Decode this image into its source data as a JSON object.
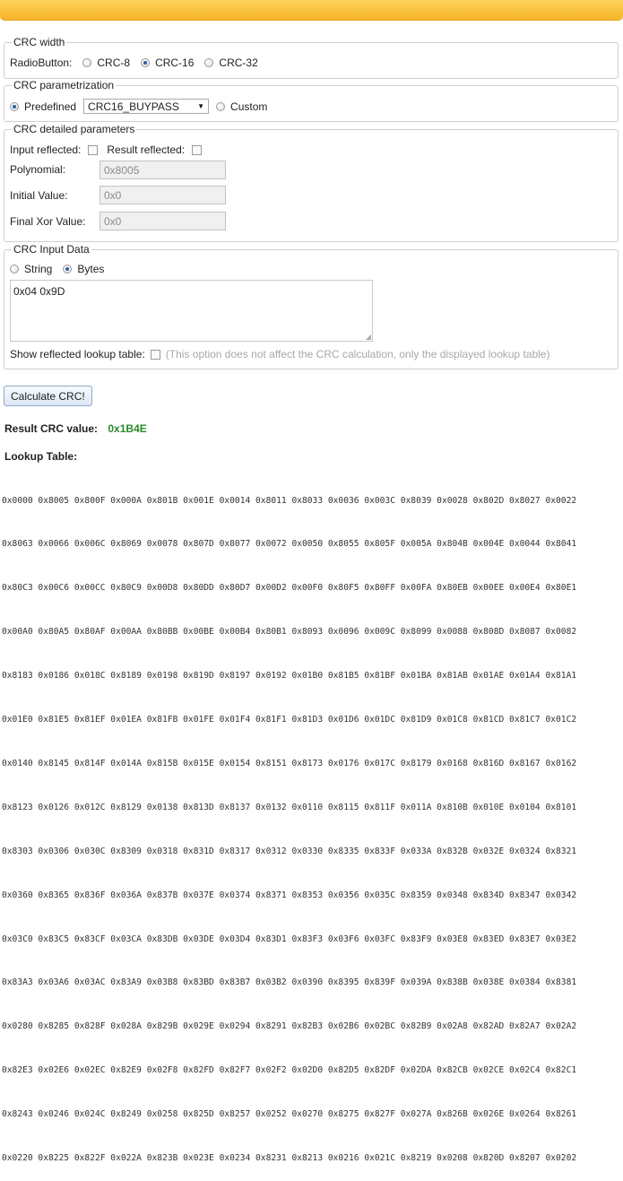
{
  "crc_width": {
    "legend": "CRC width",
    "label": "RadioButton:",
    "options": [
      "CRC-8",
      "CRC-16",
      "CRC-32"
    ],
    "selected": "CRC-16"
  },
  "crc_param": {
    "legend": "CRC parametrization",
    "predefined_label": "Predefined",
    "predefined_selected": true,
    "select_value": "CRC16_BUYPASS",
    "custom_label": "Custom"
  },
  "detailed": {
    "legend": "CRC detailed parameters",
    "input_reflected_label": "Input reflected:",
    "result_reflected_label": "Result reflected:",
    "polynomial_label": "Polynomial:",
    "polynomial_value": "0x8005",
    "initial_label": "Initial Value:",
    "initial_value": "0x0",
    "final_label": "Final Xor Value:",
    "final_value": "0x0"
  },
  "input_data": {
    "legend": "CRC Input Data",
    "string_label": "String",
    "bytes_label": "Bytes",
    "selected": "Bytes",
    "text": "0x04 0x9D",
    "reflected_label": "Show reflected lookup table:",
    "reflected_note": "(This option does not affect the CRC calculation, only the displayed lookup table)"
  },
  "calculate_label": "Calculate CRC!",
  "result": {
    "label": "Result CRC value:",
    "value": "0x1B4E"
  },
  "lookup": {
    "title": "Lookup Table:",
    "rows": [
      "0x0000 0x8005 0x800F 0x000A 0x801B 0x001E 0x0014 0x8011 0x8033 0x0036 0x003C 0x8039 0x0028 0x802D 0x8027 0x0022",
      "0x8063 0x0066 0x006C 0x8069 0x0078 0x807D 0x8077 0x0072 0x0050 0x8055 0x805F 0x005A 0x804B 0x004E 0x0044 0x8041",
      "0x80C3 0x00C6 0x00CC 0x80C9 0x00D8 0x80DD 0x80D7 0x00D2 0x00F0 0x80F5 0x80FF 0x00FA 0x80EB 0x00EE 0x00E4 0x80E1",
      "0x00A0 0x80A5 0x80AF 0x00AA 0x80BB 0x00BE 0x00B4 0x80B1 0x8093 0x0096 0x009C 0x8099 0x0088 0x808D 0x8087 0x0082",
      "0x8183 0x0186 0x018C 0x8189 0x0198 0x819D 0x8197 0x0192 0x01B0 0x81B5 0x81BF 0x01BA 0x81AB 0x01AE 0x01A4 0x81A1",
      "0x01E0 0x81E5 0x81EF 0x01EA 0x81FB 0x01FE 0x01F4 0x81F1 0x81D3 0x01D6 0x01DC 0x81D9 0x01C8 0x81CD 0x81C7 0x01C2",
      "0x0140 0x8145 0x814F 0x014A 0x815B 0x015E 0x0154 0x8151 0x8173 0x0176 0x017C 0x8179 0x0168 0x816D 0x8167 0x0162",
      "0x8123 0x0126 0x012C 0x8129 0x0138 0x813D 0x8137 0x0132 0x0110 0x8115 0x811F 0x011A 0x810B 0x010E 0x0104 0x8101",
      "0x8303 0x0306 0x030C 0x8309 0x0318 0x831D 0x8317 0x0312 0x0330 0x8335 0x833F 0x033A 0x832B 0x032E 0x0324 0x8321",
      "0x0360 0x8365 0x836F 0x036A 0x837B 0x037E 0x0374 0x8371 0x8353 0x0356 0x035C 0x8359 0x0348 0x834D 0x8347 0x0342",
      "0x03C0 0x83C5 0x83CF 0x03CA 0x83DB 0x03DE 0x03D4 0x83D1 0x83F3 0x03F6 0x03FC 0x83F9 0x03E8 0x83ED 0x83E7 0x03E2",
      "0x83A3 0x03A6 0x03AC 0x83A9 0x03B8 0x83BD 0x83B7 0x03B2 0x0390 0x8395 0x839F 0x039A 0x838B 0x038E 0x0384 0x8381",
      "0x0280 0x8285 0x828F 0x028A 0x829B 0x029E 0x0294 0x8291 0x82B3 0x02B6 0x02BC 0x82B9 0x02A8 0x82AD 0x82A7 0x02A2",
      "0x82E3 0x02E6 0x02EC 0x82E9 0x02F8 0x82FD 0x82F7 0x02F2 0x02D0 0x82D5 0x82DF 0x02DA 0x82CB 0x02CE 0x02C4 0x82C1",
      "0x8243 0x0246 0x024C 0x8249 0x0258 0x825D 0x8257 0x0252 0x0270 0x8275 0x827F 0x027A 0x826B 0x026E 0x0264 0x8261",
      "0x0220 0x8225 0x822F 0x022A 0x823B 0x023E 0x0234 0x8231 0x8213 0x0216 0x021C 0x8219 0x0208 0x820D 0x8207 0x0202"
    ]
  }
}
